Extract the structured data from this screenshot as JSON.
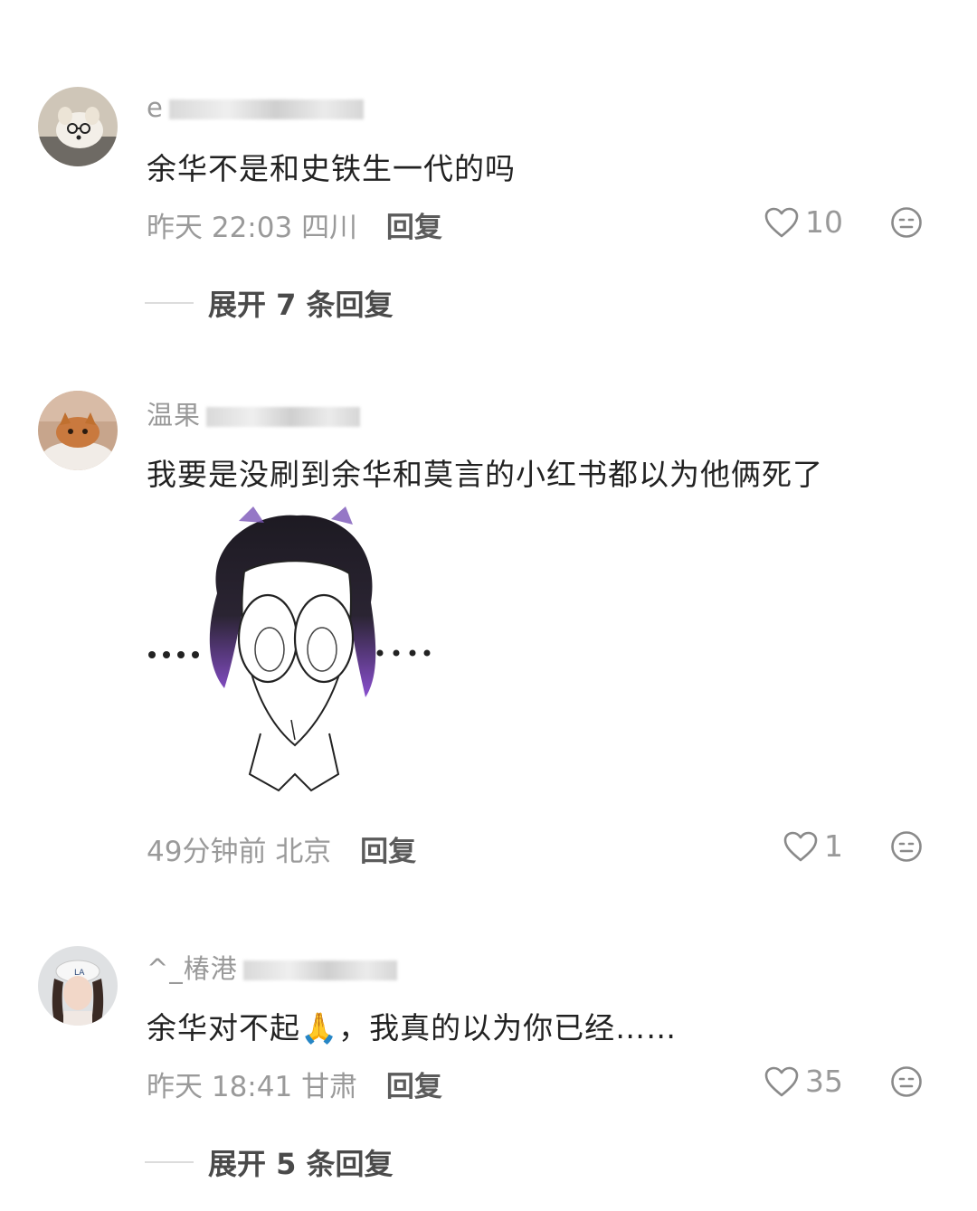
{
  "comments": [
    {
      "username": "e",
      "text": "余华不是和史铁生一代的吗",
      "time": "昨天 22:03",
      "location": "四川",
      "reply_label": "回复",
      "likes": "10",
      "expand_label": "展开 7 条回复"
    },
    {
      "username": "温果",
      "text": "我要是没刷到余华和莫言的小红书都以为他俩死了",
      "time": "49分钟前",
      "location": "北京",
      "reply_label": "回复",
      "likes": "1",
      "sticker": "anime-character-sticker"
    },
    {
      "username": "^_椿港",
      "text_before": "余华对不起",
      "emoji": "🙏",
      "text_after": "，我真的以为你已经……",
      "time": "昨天 18:41",
      "location": "甘肃",
      "reply_label": "回复",
      "likes": "35",
      "expand_label": "展开 5 条回复"
    }
  ],
  "icons": {
    "like": "heart-outline-icon",
    "dislike": "neutral-face-icon"
  },
  "colors": {
    "text": "#222222",
    "meta": "#9a9a9a",
    "reply": "#5b5b5b"
  }
}
